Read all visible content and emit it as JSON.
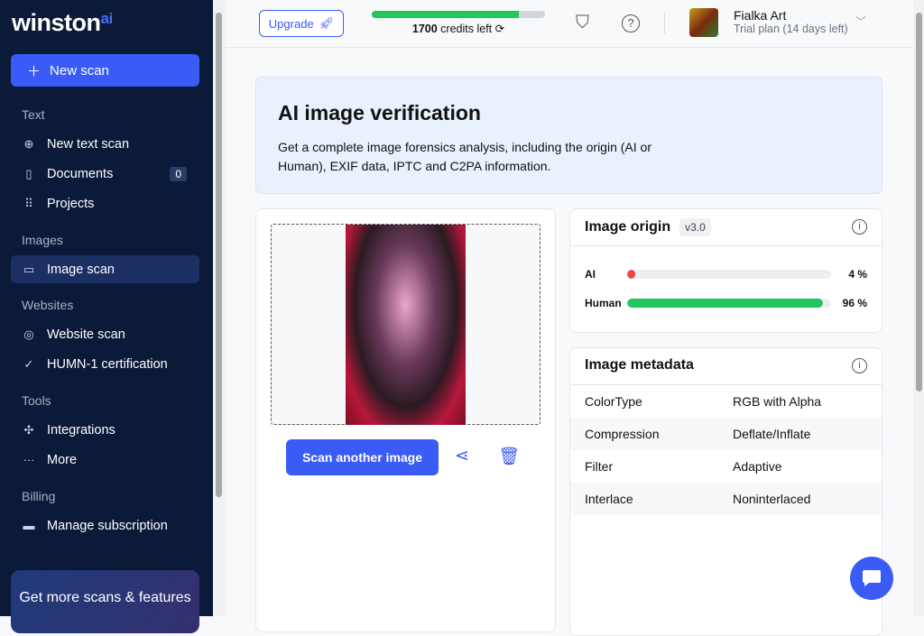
{
  "brand": {
    "name": "winston",
    "suffix": "ai"
  },
  "sidebar": {
    "new_scan": "New scan",
    "sections": {
      "text": "Text",
      "images": "Images",
      "websites": "Websites",
      "tools": "Tools",
      "billing": "Billing"
    },
    "items": {
      "new_text_scan": "New text scan",
      "documents": "Documents",
      "documents_count": "0",
      "projects": "Projects",
      "image_scan": "Image scan",
      "website_scan": "Website scan",
      "humn": "HUMN-1 certification",
      "integrations": "Integrations",
      "more": "More",
      "manage_sub": "Manage subscription"
    },
    "promo": "Get more scans & features"
  },
  "topbar": {
    "upgrade": "Upgrade",
    "credits_number": "1700",
    "credits_text": "credits left",
    "credits_fraction": 0.85,
    "user_name": "Fialka Art",
    "user_plan": "Trial plan (14 days left)"
  },
  "hero": {
    "title": "AI image verification",
    "description": "Get a complete image forensics analysis, including the origin (AI or Human), EXIF data, IPTC and C2PA information."
  },
  "scan": {
    "button": "Scan another image"
  },
  "origin": {
    "title": "Image origin",
    "version": "v3.0",
    "rows": [
      {
        "label": "AI",
        "value": "4 %",
        "percent": 4,
        "color": "#ef4444"
      },
      {
        "label": "Human",
        "value": "96 %",
        "percent": 96,
        "color": "#22c55e"
      }
    ]
  },
  "metadata": {
    "title": "Image metadata",
    "rows": [
      {
        "key": "ColorType",
        "value": "RGB with Alpha"
      },
      {
        "key": "Compression",
        "value": "Deflate/Inflate"
      },
      {
        "key": "Filter",
        "value": "Adaptive"
      },
      {
        "key": "Interlace",
        "value": "Noninterlaced"
      }
    ]
  }
}
